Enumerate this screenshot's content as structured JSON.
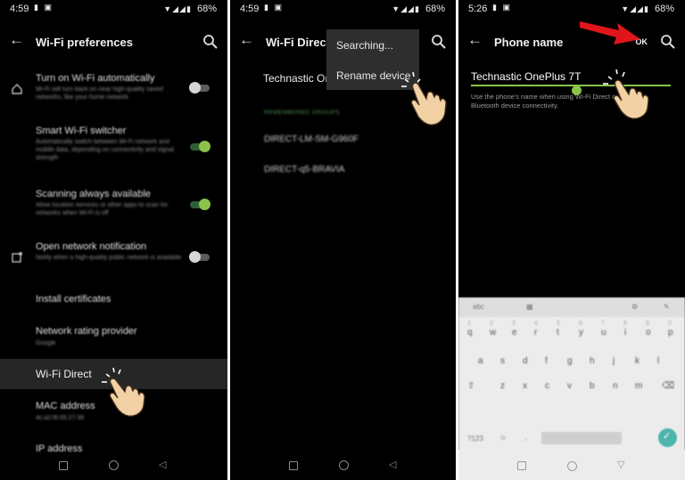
{
  "panel1": {
    "status": {
      "time": "4:59",
      "battery": "68%"
    },
    "title": "Wi-Fi preferences",
    "items": [
      {
        "title": "Turn on Wi-Fi automatically",
        "subtitle": "Wi-Fi will turn back on near high-quality saved networks, like your home network",
        "toggle": "off"
      },
      {
        "title": "Smart Wi-Fi switcher",
        "subtitle": "Automatically switch between Wi-Fi network and mobile data, depending on connectivity and signal strength",
        "toggle": "on"
      },
      {
        "title": "Scanning always available",
        "subtitle": "Allow location services or other apps to scan for networks when Wi-Fi is off",
        "toggle": "on"
      },
      {
        "title": "Open network notification",
        "subtitle": "Notify when a high-quality public network is available",
        "toggle": "off"
      },
      {
        "title": "Install certificates"
      },
      {
        "title": "Network rating provider",
        "subtitle": "Google"
      },
      {
        "title": "MAC address",
        "subtitle": "4c:a2:f8:05:27:38"
      },
      {
        "title": "IP address"
      }
    ],
    "highlighted": "Wi-Fi Direct"
  },
  "panel2": {
    "status": {
      "time": "4:59",
      "battery": "68%"
    },
    "title": "Wi-Fi Direct",
    "device_name": "Technastic OnePlus 7T",
    "section": "REMEMBERED GROUPS",
    "devices": [
      "DIRECT-LM-SM-G960F",
      "DIRECT-q5-BRAVIA"
    ],
    "menu": [
      "Searching...",
      "Rename device"
    ]
  },
  "panel3": {
    "status": {
      "time": "5:26",
      "battery": "68%"
    },
    "title": "Phone name",
    "ok_label": "OK",
    "input_value": "Technastic OnePlus 7T",
    "helper": "Use the phone's name when using Wi-Fi Direct or Bluetooth device connectivity.",
    "keyboard": {
      "top": [
        "abc",
        "▦",
        "⚙",
        "✎"
      ],
      "row1": [
        "q",
        "w",
        "e",
        "r",
        "t",
        "y",
        "u",
        "i",
        "o",
        "p"
      ],
      "row1_nums": [
        "1",
        "2",
        "3",
        "4",
        "5",
        "6",
        "7",
        "8",
        "9",
        "0"
      ],
      "row2": [
        "a",
        "s",
        "d",
        "f",
        "g",
        "h",
        "j",
        "k",
        "l"
      ],
      "row3": [
        "z",
        "x",
        "c",
        "v",
        "b",
        "n",
        "m"
      ],
      "fn": [
        "?123",
        "☺",
        ","
      ]
    }
  },
  "colors": {
    "accent": "#8bc34a",
    "arrow": "#e0151b",
    "enter": "#4db6ac"
  },
  "icons": [
    "wifi-icon",
    "signal-icon",
    "battery-icon",
    "back-arrow-icon",
    "search-icon",
    "home-icon",
    "notification-icon",
    "hand-pointer-icon",
    "red-arrow-icon",
    "enter-check-icon"
  ]
}
